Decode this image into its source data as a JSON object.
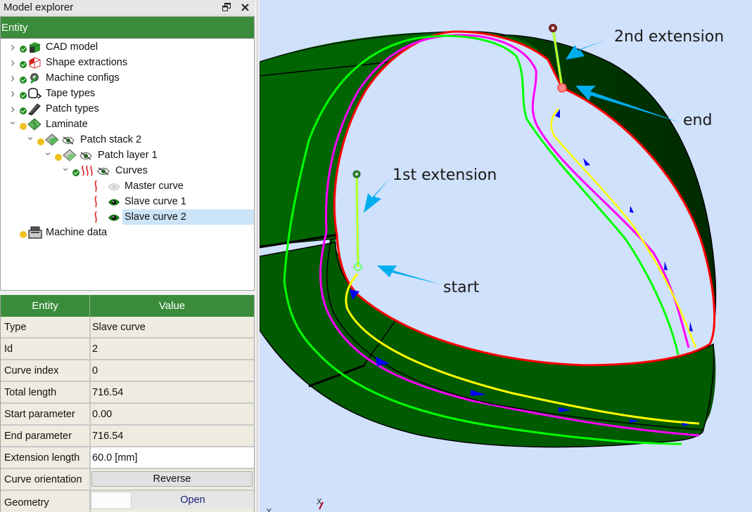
{
  "dock": {
    "title": "Model explorer",
    "float_icon": "⧉",
    "close_icon": "✕"
  },
  "tree": {
    "header": "Entity",
    "items": [
      {
        "label": "CAD model",
        "status": "ok",
        "icon": "cad-model-icon",
        "expanded": false,
        "level": 0
      },
      {
        "label": "Shape extractions",
        "status": "ok",
        "icon": "shape-extraction-icon",
        "expanded": false,
        "level": 0
      },
      {
        "label": "Machine configs",
        "status": "ok",
        "icon": "machine-config-icon",
        "expanded": false,
        "level": 0
      },
      {
        "label": "Tape types",
        "status": "ok",
        "icon": "tape-type-icon",
        "expanded": false,
        "level": 0
      },
      {
        "label": "Patch types",
        "status": "ok",
        "icon": "patch-type-icon",
        "expanded": false,
        "level": 0
      },
      {
        "label": "Laminate",
        "status": "warn",
        "icon": "laminate-icon",
        "expanded": true,
        "level": 0
      },
      {
        "label": "Patch stack 2",
        "status": "warn",
        "icon": "patch-stack-icon",
        "expanded": true,
        "level": 1,
        "visibility": "partial"
      },
      {
        "label": "Patch layer 1",
        "status": "warn",
        "icon": "patch-layer-icon",
        "expanded": true,
        "level": 2,
        "visibility": "partial"
      },
      {
        "label": "Curves",
        "status": "ok",
        "icon": "curves-icon",
        "expanded": true,
        "level": 3,
        "visibility": "partial"
      },
      {
        "label": "Master curve",
        "icon": "curve-icon",
        "level": 4,
        "visibility": "hidden"
      },
      {
        "label": "Slave curve 1",
        "icon": "curve-icon",
        "level": 4,
        "visibility": "visible"
      },
      {
        "label": "Slave curve 2",
        "icon": "curve-icon",
        "level": 4,
        "visibility": "visible",
        "selected": true
      },
      {
        "label": "Machine data",
        "status": "warn",
        "icon": "machine-data-icon",
        "level": 0
      }
    ]
  },
  "properties": {
    "header_entity": "Entity",
    "header_value": "Value",
    "rows": [
      {
        "key": "Type",
        "value": "Slave curve"
      },
      {
        "key": "Id",
        "value": "2"
      },
      {
        "key": "Curve index",
        "value": "0"
      },
      {
        "key": "Total length",
        "value": "716.54"
      },
      {
        "key": "Start parameter",
        "value": "0.00"
      },
      {
        "key": "End parameter",
        "value": "716.54"
      },
      {
        "key": "Extension length",
        "value": "60.0 [mm]"
      },
      {
        "key": "Curve orientation",
        "button": "Reverse"
      },
      {
        "key": "Geometry",
        "button": "Open"
      }
    ]
  },
  "viewport": {
    "annotations": {
      "second_extension": "2nd extension",
      "end": "end",
      "first_extension": "1st extension",
      "start": "start"
    },
    "axes": {
      "x": "X",
      "y": "Y"
    },
    "colors": {
      "background": "#d0e1fb",
      "surface": "#006400",
      "edge_red": "#ff0000",
      "master_curve_magenta": "#ff00ff",
      "slave_curve_green": "#00ff00",
      "selected_curve_yellow": "#ffff00",
      "direction_arrow": "#0000ff",
      "callout_arrow": "#00aeef"
    }
  }
}
